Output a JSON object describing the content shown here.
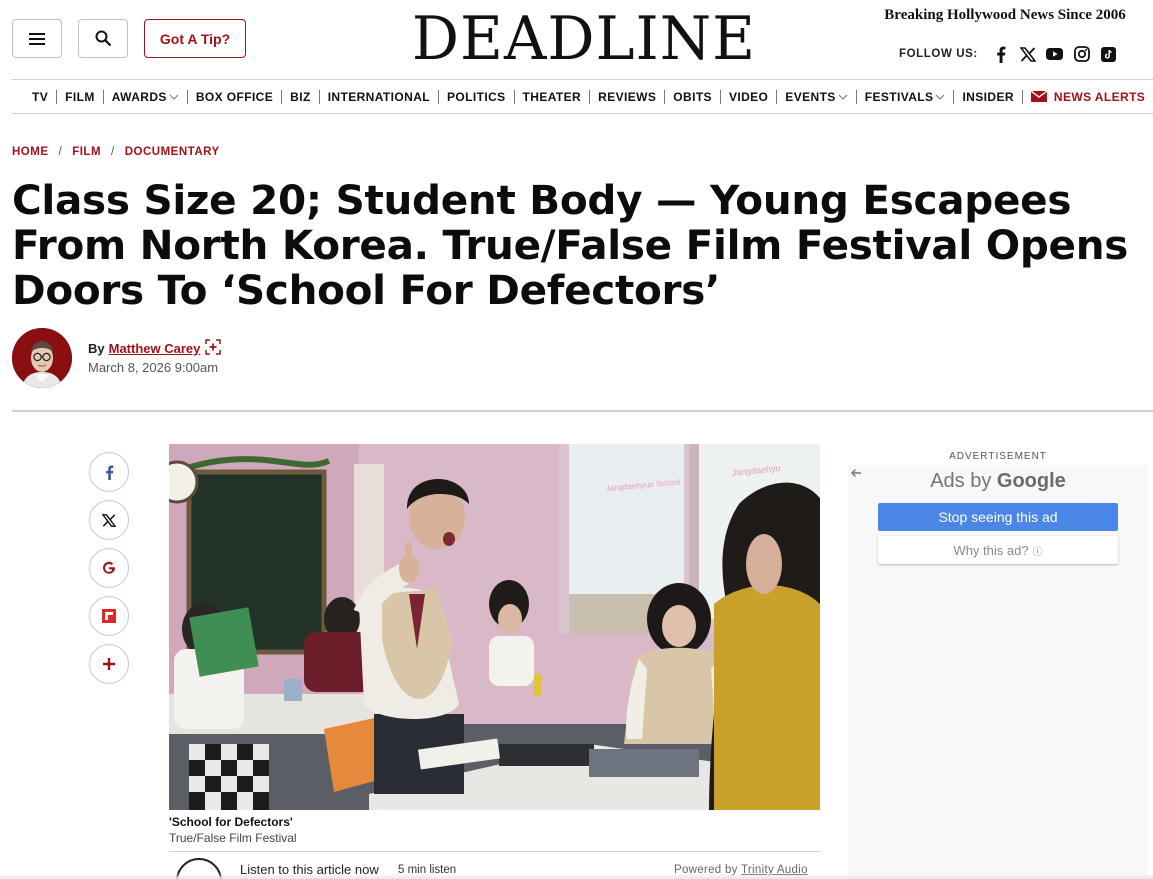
{
  "header": {
    "logo": "DEADLINE",
    "tagline": "Breaking Hollywood News Since 2006",
    "tip_label": "Got A Tip?",
    "follow_label": "FOLLOW US:",
    "social_icons": [
      "facebook-icon",
      "x-icon",
      "youtube-icon",
      "instagram-icon",
      "tiktok-icon"
    ]
  },
  "nav": {
    "items": [
      {
        "label": "TV"
      },
      {
        "label": "FILM"
      },
      {
        "label": "AWARDS"
      },
      {
        "label": "BOX OFFICE"
      },
      {
        "label": "BIZ"
      },
      {
        "label": "INTERNATIONAL"
      },
      {
        "label": "POLITICS"
      },
      {
        "label": "THEATER"
      },
      {
        "label": "REVIEWS"
      },
      {
        "label": "OBITS"
      },
      {
        "label": "VIDEO"
      },
      {
        "label": "EVENTS"
      },
      {
        "label": "FESTIVALS"
      },
      {
        "label": "INSIDER"
      }
    ],
    "alerts": "NEWS ALERTS"
  },
  "breadcrumb": [
    "HOME",
    "FILM",
    "DOCUMENTARY"
  ],
  "article": {
    "headline": "Class Size 20; Student Body — Young Escapees From North Korea. True/False Film Festival Opens Doors To ‘School For Defectors’",
    "by": "By",
    "author": "Matthew Carey",
    "date": "March 8, 2026 9:00am",
    "caption_title": "'School for Defectors'",
    "caption_credit": "True/False Film Festival",
    "photo_signs": [
      "Jangdaehyun School",
      "Jangdaehyu"
    ],
    "audio": {
      "listen_label": "Listen to this article now",
      "duration": "5 min listen",
      "powered_prefix": "Powered by",
      "powered_brand": "Trinity Audio"
    }
  },
  "share": [
    "facebook-icon",
    "x-icon",
    "google-icon",
    "flipboard-icon",
    "more-icon"
  ],
  "ad": {
    "label": "ADVERTISEMENT",
    "ads_by": "Ads by",
    "google": "Google",
    "stop": "Stop seeing this ad",
    "why": "Why this ad?",
    "info": "ⓘ"
  },
  "colors": {
    "brand_red": "#a01218",
    "ad_blue": "#4a86e8"
  }
}
